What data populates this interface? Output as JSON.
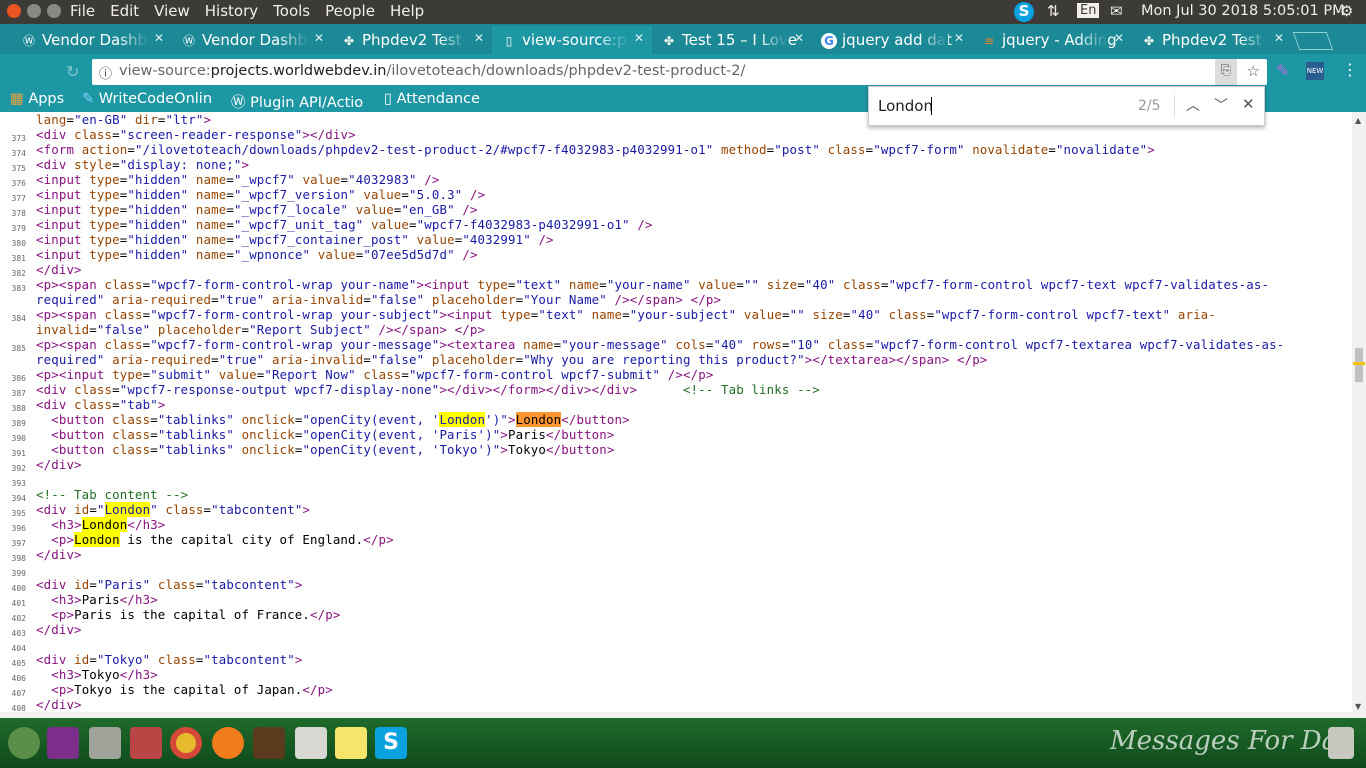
{
  "os": {
    "menu": [
      "File",
      "Edit",
      "View",
      "History",
      "Tools",
      "People",
      "Help"
    ],
    "keyboard": "En",
    "datetime": "Mon Jul 30 2018 5:05:01 PM"
  },
  "tabs": [
    {
      "title": "Vendor Dashb",
      "icon": "wordpress-icon"
    },
    {
      "title": "Vendor Dashb",
      "icon": "wordpress-icon"
    },
    {
      "title": "Phpdev2 Test",
      "icon": "puzzle-icon"
    },
    {
      "title": "view-source:p",
      "icon": "page-icon",
      "active": true
    },
    {
      "title": "Test 15 – I Love",
      "icon": "puzzle-icon"
    },
    {
      "title": "jquery add dat",
      "icon": "google-icon"
    },
    {
      "title": "jquery - Adding",
      "icon": "stackoverflow-icon"
    },
    {
      "title": "Phpdev2 Test",
      "icon": "puzzle-icon"
    }
  ],
  "address": {
    "prefix": "view-source:",
    "host": "projects.worldwebdev.in",
    "path": "/ilovetoteach/downloads/phpdev2-test-product-2/"
  },
  "bookmarks": [
    "Apps",
    "WriteCodeOnlin",
    "Plugin API/Actio",
    "Attendance"
  ],
  "find": {
    "query": "London",
    "count": "2/5"
  },
  "source": {
    "top_partial": "lang=\"en-GB\" dir=\"ltr\">",
    "line_numbers": [
      "373",
      "374",
      "375",
      "376",
      "377",
      "378",
      "379",
      "380",
      "381",
      "382",
      "383",
      "",
      "384",
      "",
      "385",
      "",
      "386",
      "387",
      "388",
      "389",
      "390",
      "391",
      "392",
      "393",
      "394",
      "395",
      "396",
      "397",
      "398",
      "399",
      "400",
      "401",
      "402",
      "403",
      "404",
      "405",
      "406",
      "407",
      "408"
    ]
  },
  "dock": {
    "watermark": "Messages For Day"
  }
}
